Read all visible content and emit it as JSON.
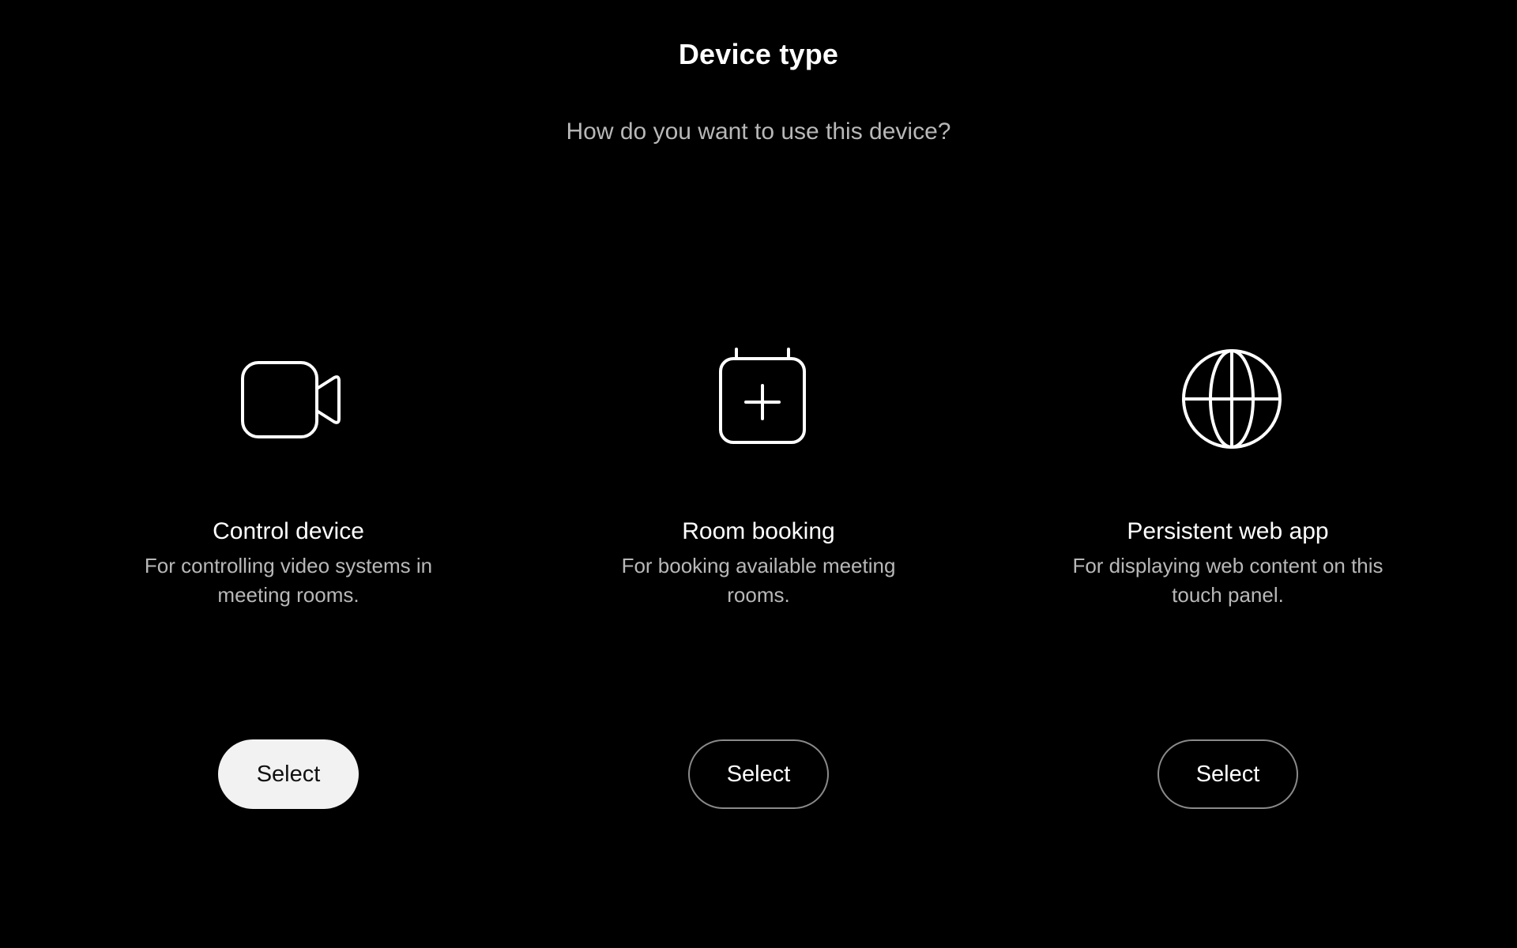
{
  "header": {
    "title": "Device type",
    "subtitle": "How do you want to use this device?"
  },
  "options": [
    {
      "icon": "video-camera-icon",
      "title": "Control device",
      "description": "For controlling video systems in meeting rooms.",
      "button_label": "Select",
      "selected": true
    },
    {
      "icon": "calendar-add-icon",
      "title": "Room booking",
      "description": "For booking available meeting rooms.",
      "button_label": "Select",
      "selected": false
    },
    {
      "icon": "globe-icon",
      "title": "Persistent web app",
      "description": "For displaying web content on this touch panel.",
      "button_label": "Select",
      "selected": false
    }
  ],
  "colors": {
    "background": "#000000",
    "text_primary": "#ffffff",
    "text_secondary": "#b8b8b8",
    "button_selected_bg": "#f2f2f2",
    "button_border": "#8a8a8a"
  }
}
